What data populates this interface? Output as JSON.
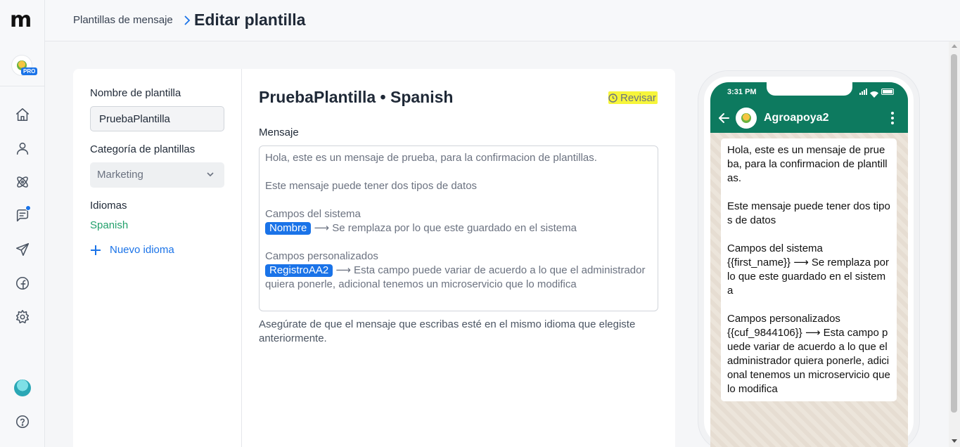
{
  "app": {
    "logo": "m",
    "plan_badge": "PRO"
  },
  "nav": {
    "items": [
      "home-icon",
      "contacts-icon",
      "integrations-icon",
      "chat-icon",
      "campaigns-icon",
      "facebook-icon",
      "settings-icon"
    ],
    "bottom": [
      "user-avatar",
      "help-icon"
    ]
  },
  "header": {
    "breadcrumb": "Plantillas de mensaje",
    "title": "Editar plantilla"
  },
  "form": {
    "name_label": "Nombre de plantilla",
    "name_value": "PruebaPlantilla",
    "category_label": "Categoría de plantillas",
    "category_value": "Marketing",
    "languages_label": "Idiomas",
    "language_item": "Spanish",
    "new_language": "Nuevo idioma"
  },
  "editor": {
    "title": "PruebaPlantilla • Spanish",
    "status": "Revisar",
    "message_label": "Mensaje",
    "line1": "Hola, este es un mensaje de prueba, para la confirmacion de plantillas.",
    "line2": "Este mensaje puede tener dos tipos de datos",
    "line3": "Campos del sistema",
    "chip1": "Nombre",
    "line4": "⟶ Se remplaza por lo que este guardado en el sistema",
    "line5": "Campos personalizados",
    "chip2": "RegistroAA2",
    "line6": "⟶ Esta campo puede variar de acuerdo a lo que el administrador quiera ponerle, adicional tenemos un microservicio que lo modifica",
    "hint": "Asegúrate de que el mensaje que escribas esté en el mismo idioma que elegiste anteriormente."
  },
  "preview": {
    "time": "3:31 PM",
    "contact_name": "Agroapoya2",
    "b1": "Hola, este es un mensaje de prueba, para la confirmacion de plantillas.",
    "b2": "Este mensaje puede tener dos tipos de datos",
    "b3": "Campos del sistema",
    "b4": "{{first_name}} ⟶ Se remplaza por lo que este guardado en el sistema",
    "b5": "Campos personalizados",
    "b6": "{{cuf_9844106}} ⟶ Esta campo puede variar de acuerdo a lo que el administrador quiera ponerle, adicional tenemos un microservicio que lo modifica"
  },
  "colors": {
    "accent": "#1a73e8",
    "whatsapp_green": "#0d7a5f",
    "success": "#22a06b",
    "highlight": "#f6f53a"
  }
}
